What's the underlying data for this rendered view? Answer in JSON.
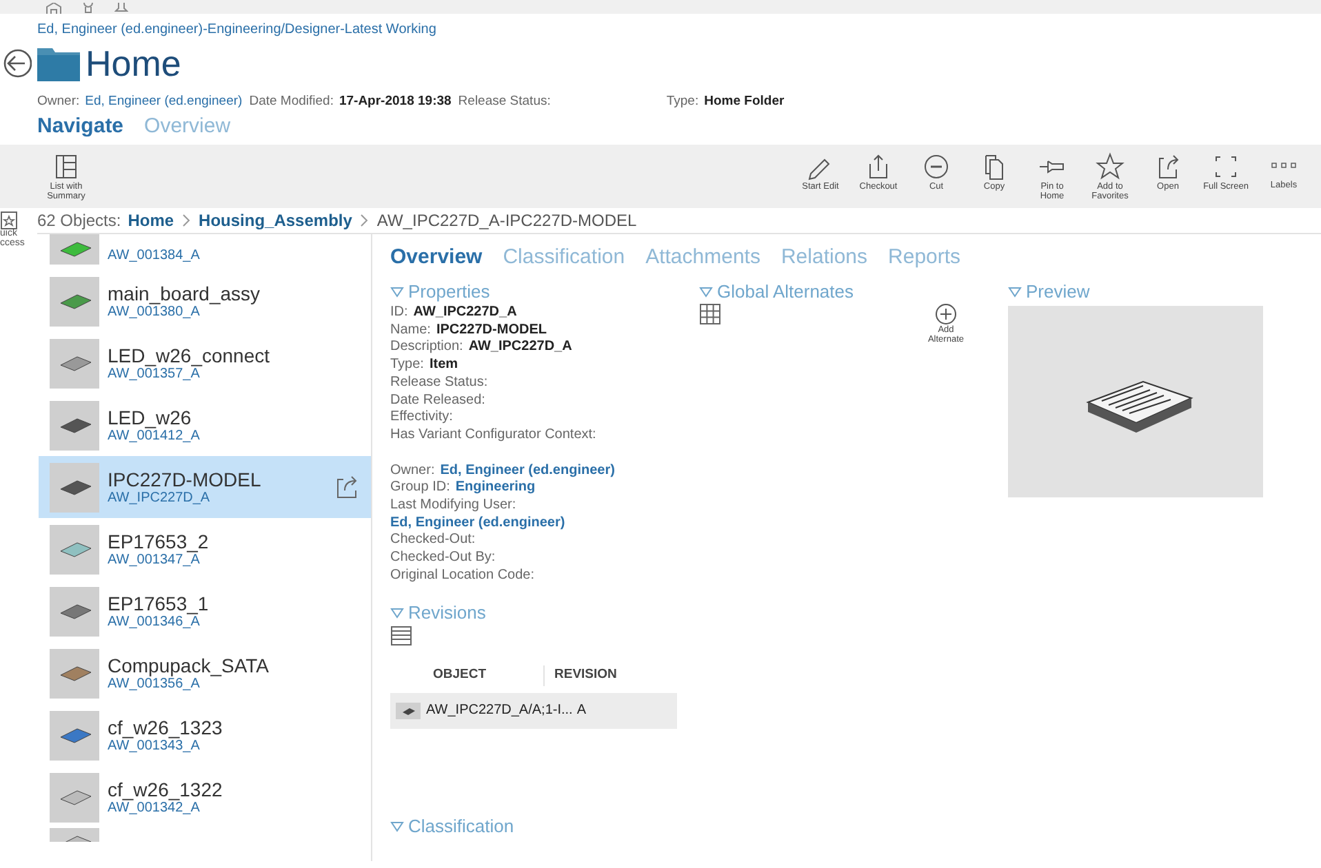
{
  "context_line": "Ed, Engineer (ed.engineer)-Engineering/Designer-Latest Working",
  "page": {
    "title": "Home",
    "meta": [
      {
        "label": "Owner:",
        "value": "Ed, Engineer (ed.engineer)",
        "kind": "link"
      },
      {
        "label": "Date Modified:",
        "value": "17-Apr-2018 19:38",
        "kind": "bold"
      },
      {
        "label": "Release Status:"
      },
      {
        "label": "Type:",
        "value": "Home Folder",
        "kind": "bold"
      }
    ]
  },
  "page_tabs": [
    {
      "label": "Navigate",
      "selected": true
    },
    {
      "label": "Overview",
      "selected": false
    }
  ],
  "toolbar_left": [
    {
      "label": "List with\nSummary"
    }
  ],
  "toolbar_right": [
    {
      "label": "Start Edit"
    },
    {
      "label": "Checkout"
    },
    {
      "label": "Cut"
    },
    {
      "label": "Copy"
    },
    {
      "label": "Pin to\nHome"
    },
    {
      "label": "Add to\nFavorites"
    },
    {
      "label": "Open"
    },
    {
      "label": "Full Screen"
    },
    {
      "label": "Labels"
    }
  ],
  "quick_access": [
    "uick",
    "ccess"
  ],
  "breadcrumb": {
    "count": "62 Objects:",
    "path": [
      {
        "label": "Home",
        "kind": "link"
      },
      {
        "label": "Housing_Assembly",
        "kind": "link"
      },
      {
        "label": "AW_IPC227D_A-IPC227D-MODEL",
        "kind": "current"
      }
    ]
  },
  "objects": [
    {
      "id": "AW_001384_A",
      "selected": false
    },
    {
      "name": "main_board_assy",
      "id": "AW_001380_A",
      "selected": false
    },
    {
      "name": "LED_w26_connect",
      "id": "AW_001357_A",
      "selected": false
    },
    {
      "name": "LED_w26",
      "id": "AW_001412_A",
      "selected": false
    },
    {
      "name": "IPC227D-MODEL",
      "id": "AW_IPC227D_A",
      "selected": true
    },
    {
      "name": "EP17653_2",
      "id": "AW_001347_A",
      "selected": false
    },
    {
      "name": "EP17653_1",
      "id": "AW_001346_A",
      "selected": false
    },
    {
      "name": "Compupack_SATA",
      "id": "AW_001356_A",
      "selected": false
    },
    {
      "name": "cf_w26_1323",
      "id": "AW_001343_A",
      "selected": false
    },
    {
      "name": "cf_w26_1322",
      "id": "AW_001342_A",
      "selected": false
    },
    {
      "selected": false
    }
  ],
  "detail_tabs": [
    {
      "label": "Overview",
      "selected": true
    },
    {
      "label": "Classification",
      "selected": false
    },
    {
      "label": "Attachments",
      "selected": false
    },
    {
      "label": "Relations",
      "selected": false
    },
    {
      "label": "Reports",
      "selected": false
    }
  ],
  "properties": {
    "title": "Properties",
    "expanded": true,
    "groups": [
      [
        {
          "label": "ID:",
          "value": "AW_IPC227D_A",
          "kind": "bold"
        },
        {
          "label": "Name:",
          "value": "IPC227D-MODEL",
          "kind": "bold"
        },
        {
          "label": "Description:",
          "value": "AW_IPC227D_A",
          "kind": "bold"
        },
        {
          "label": "Type:",
          "value": "Item",
          "kind": "bold"
        },
        {
          "label": "Release Status:"
        },
        {
          "label": "Date Released:"
        },
        {
          "label": "Effectivity:"
        },
        {
          "label": "Has Variant Configurator Context:"
        }
      ],
      [
        {
          "label": "Owner:",
          "value": "Ed, Engineer (ed.engineer)",
          "kind": "link"
        },
        {
          "label": "Group ID:",
          "value": "Engineering",
          "kind": "link"
        },
        {
          "label": "Last Modifying User:",
          "value": "Ed, Engineer (ed.engineer)",
          "kind": "link_below"
        },
        {
          "label": "Checked-Out:"
        },
        {
          "label": "Checked-Out By:"
        },
        {
          "label": "Original Location Code:"
        }
      ]
    ]
  },
  "global_alternates": {
    "title": "Global Alternates",
    "expanded": true,
    "add_label": "Add\nAlternate"
  },
  "preview": {
    "title": "Preview",
    "expanded": true
  },
  "revisions": {
    "title": "Revisions",
    "expanded": true,
    "columns": [
      "OBJECT",
      "REVISION"
    ],
    "rows": [
      [
        "AW_IPC227D_A/A;1-I...",
        "A"
      ]
    ]
  },
  "classification": {
    "title": "Classification",
    "expanded": true
  }
}
